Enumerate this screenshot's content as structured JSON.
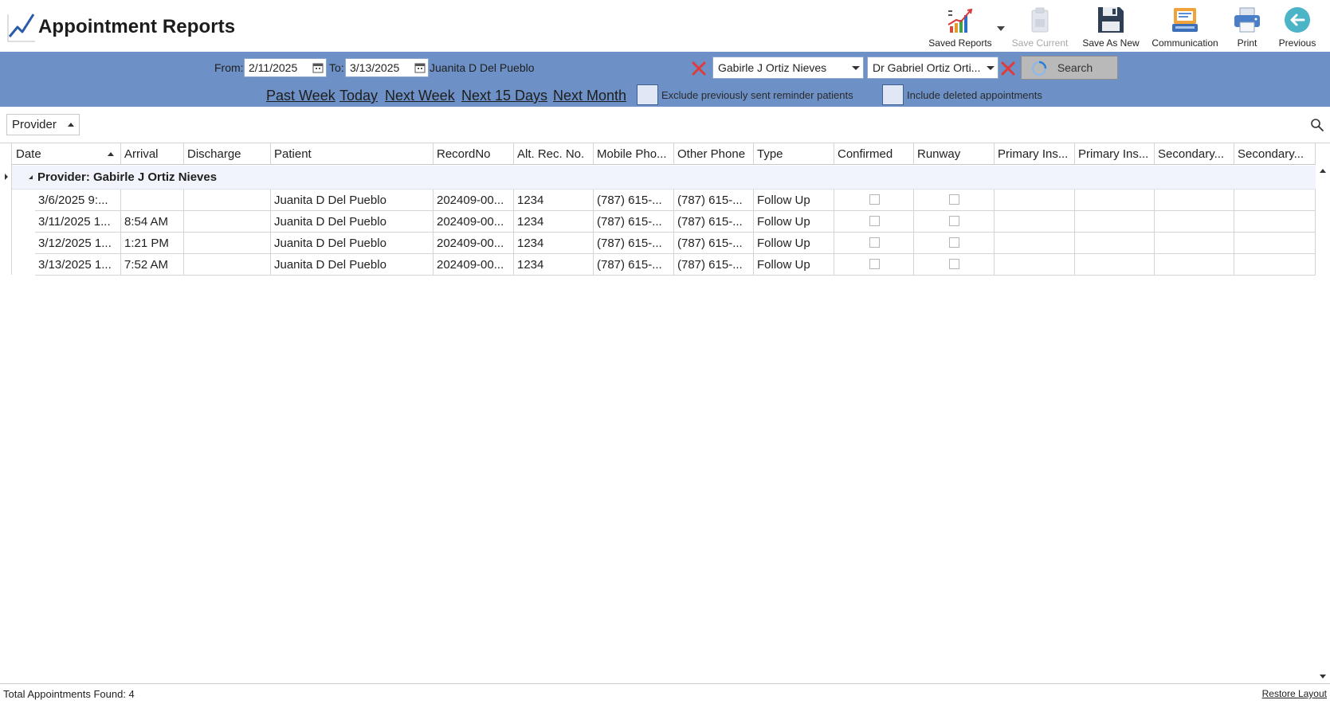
{
  "app": {
    "title": "Appointment Reports"
  },
  "toolbar": {
    "saved_reports": "Saved Reports",
    "save_current": "Save Current",
    "save_as_new": "Save As New",
    "communication": "Communication",
    "print": "Print",
    "previous": "Previous"
  },
  "filters": {
    "from_label": "From:",
    "from_value": "2/11/2025",
    "to_label": "To:",
    "to_value": "3/13/2025",
    "patient_name": "Juanita D Del Pueblo",
    "provider_combo": "Gabirle J Ortiz Nieves",
    "doctor_combo": "Dr Gabriel Ortiz Orti...",
    "search_label": "Search",
    "quick_links": [
      "Past Week",
      "Today",
      "Next Week",
      "Next 15 Days",
      "Next Month"
    ],
    "exclude_label": "Exclude previously sent reminder patients",
    "include_deleted_label": "Include deleted appointments"
  },
  "grid": {
    "group_by": "Provider",
    "columns": [
      "Date",
      "Arrival",
      "Discharge",
      "Patient",
      "RecordNo",
      "Alt. Rec. No.",
      "Mobile Pho...",
      "Other Phone",
      "Type",
      "Confirmed",
      "Runway",
      "Primary Ins...",
      "Primary Ins...",
      "Secondary...",
      "Secondary..."
    ],
    "group_label": "Provider: Gabirle J Ortiz Nieves",
    "rows": [
      {
        "date": "3/6/2025 9:...",
        "arrival": "",
        "discharge": "",
        "patient": "Juanita D Del Pueblo",
        "record": "202409-00...",
        "alt": "1234",
        "mobile": "(787) 615-...",
        "other": "(787) 615-...",
        "type": "Follow Up"
      },
      {
        "date": "3/11/2025 1...",
        "arrival": "8:54 AM",
        "discharge": "",
        "patient": "Juanita D Del Pueblo",
        "record": "202409-00...",
        "alt": "1234",
        "mobile": "(787) 615-...",
        "other": "(787) 615-...",
        "type": "Follow Up"
      },
      {
        "date": "3/12/2025 1...",
        "arrival": "1:21 PM",
        "discharge": "",
        "patient": "Juanita D Del Pueblo",
        "record": "202409-00...",
        "alt": "1234",
        "mobile": "(787) 615-...",
        "other": "(787) 615-...",
        "type": "Follow Up"
      },
      {
        "date": "3/13/2025 1...",
        "arrival": "7:52 AM",
        "discharge": "",
        "patient": "Juanita D Del Pueblo",
        "record": "202409-00...",
        "alt": "1234",
        "mobile": "(787) 615-...",
        "other": "(787) 615-...",
        "type": "Follow Up"
      }
    ]
  },
  "footer": {
    "total": "Total Appointments Found: 4",
    "restore": "Restore Layout"
  },
  "colors": {
    "filter_band": "#6d91c6",
    "group_row": "#f1f5fb",
    "clear_x": "#e03a3a"
  }
}
